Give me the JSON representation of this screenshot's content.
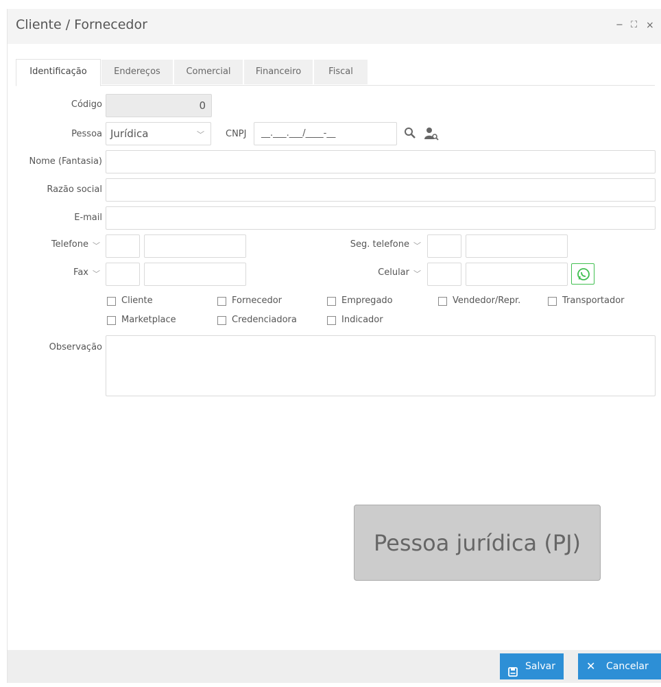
{
  "window": {
    "title": "Cliente / Fornecedor",
    "minimize": "−",
    "maximize": "⛶",
    "close": "×"
  },
  "tabs": [
    {
      "label": "Identificação"
    },
    {
      "label": "Endereços"
    },
    {
      "label": "Comercial"
    },
    {
      "label": "Financeiro"
    },
    {
      "label": "Fiscal"
    }
  ],
  "form": {
    "codigo": {
      "label": "Código",
      "value": "0"
    },
    "pessoa": {
      "label": "Pessoa",
      "value": "Jurídica"
    },
    "cnpj": {
      "label": "CNPJ",
      "value": "__.___.___/____-__"
    },
    "nome": {
      "label": "Nome (Fantasia)",
      "value": ""
    },
    "razao": {
      "label": "Razão social",
      "value": ""
    },
    "email": {
      "label": "E-mail",
      "value": ""
    },
    "telefone": {
      "label": "Telefone"
    },
    "seg_telefone": {
      "label": "Seg. telefone"
    },
    "fax": {
      "label": "Fax"
    },
    "celular": {
      "label": "Celular"
    },
    "checks": [
      "Cliente",
      "Fornecedor",
      "Empregado",
      "Vendedor/Repr.",
      "Transportador",
      "Marketplace",
      "Credenciadora",
      "Indicador"
    ],
    "observacao": {
      "label": "Observação",
      "value": ""
    }
  },
  "badge": "Pessoa jurídica (PJ)",
  "footer": {
    "save_label": "Salvar",
    "cancel_label": "Cancelar"
  },
  "colors": {
    "primary": "#2d8fd6",
    "whatsapp": "#3fbf4f",
    "badge_bg": "#cccccc"
  }
}
